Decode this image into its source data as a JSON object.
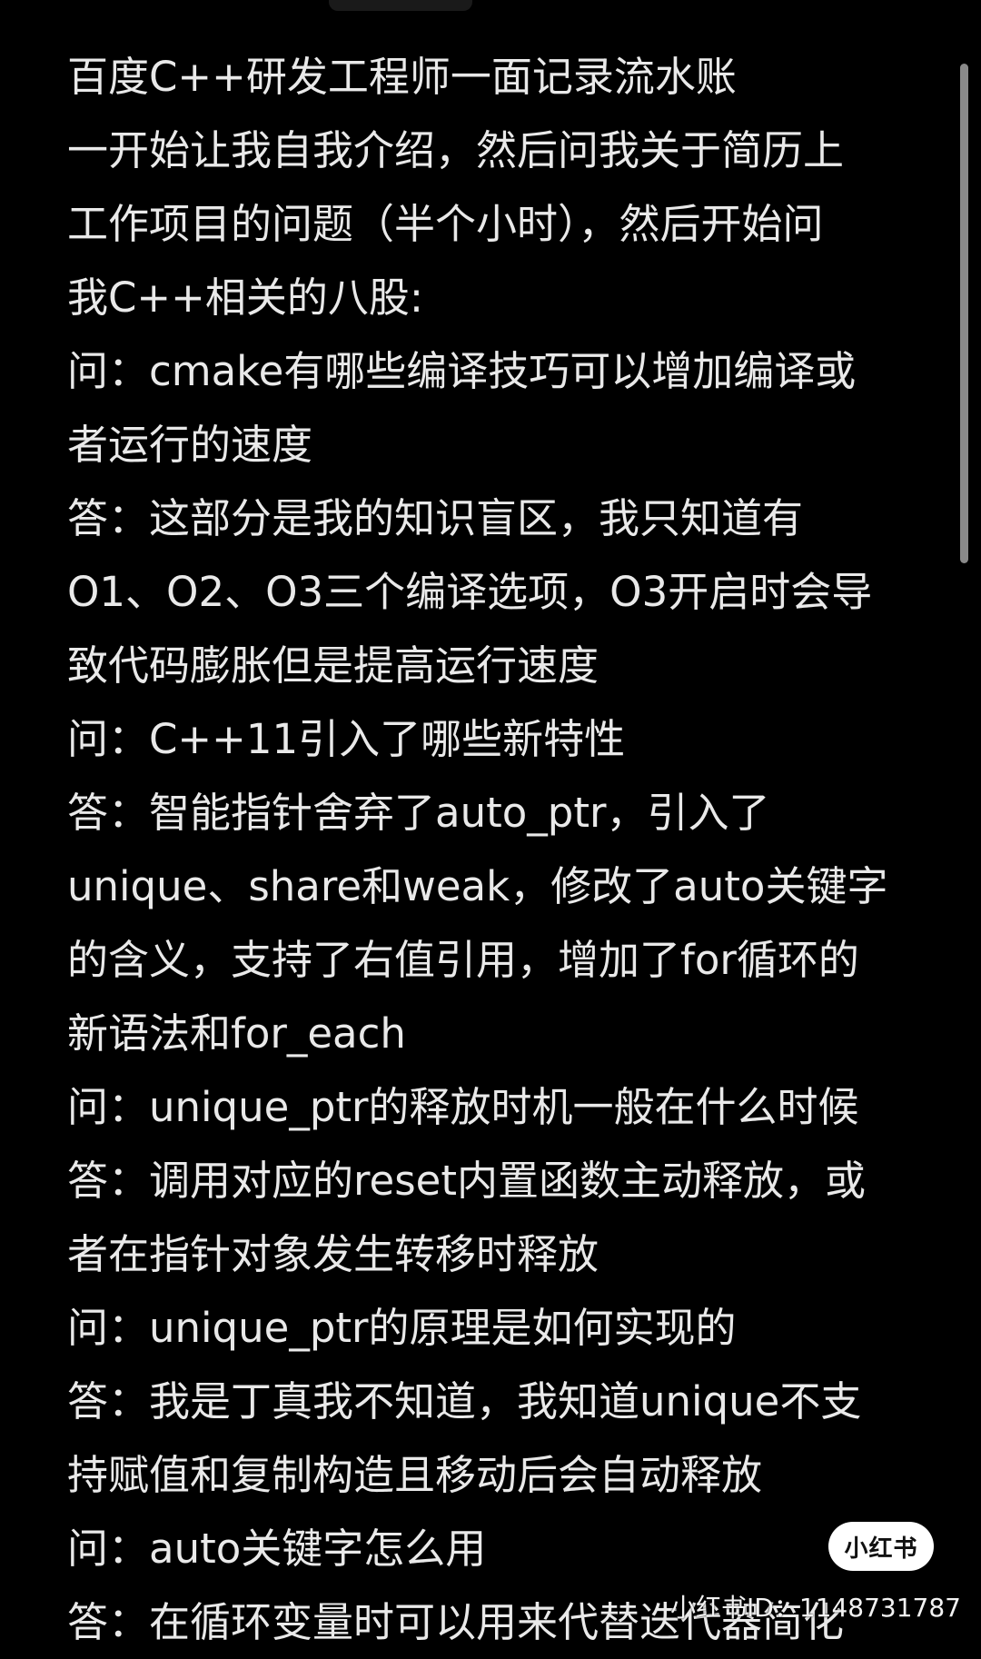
{
  "note": {
    "lines": [
      "百度C++研发工程师一面记录流水账",
      "一开始让我自我介绍，然后问我关于简历上",
      "工作项目的问题（半个小时），然后开始问",
      "我C++相关的八股:",
      "问：cmake有哪些编译技巧可以增加编译或",
      "者运行的速度",
      "答：这部分是我的知识盲区，我只知道有",
      "O1、O2、O3三个编译选项，O3开启时会导",
      "致代码膨胀但是提高运行速度",
      "问：C++11引入了哪些新特性",
      "答：智能指针舍弃了auto_ptr，引入了",
      "unique、share和weak，修改了auto关键字",
      "的含义，支持了右值引用，增加了for循环的",
      "新语法和for_each",
      "问：unique_ptr的释放时机一般在什么时候",
      "答：调用对应的reset内置函数主动释放，或",
      "者在指针对象发生转移时释放",
      "问：unique_ptr的原理是如何实现的",
      "答：我是丁真我不知道，我知道unique不支",
      "持赋值和复制构造且移动后会自动释放",
      "问：auto关键字怎么用",
      "答：在循环变量时可以用来代替迭代器简化"
    ]
  },
  "watermark": {
    "logo_text": "小红书",
    "id_text": "小红书ID：1148731787"
  },
  "colors": {
    "background": "#000000",
    "text": "#e9e9e9",
    "logo_bg": "#ffffff"
  }
}
